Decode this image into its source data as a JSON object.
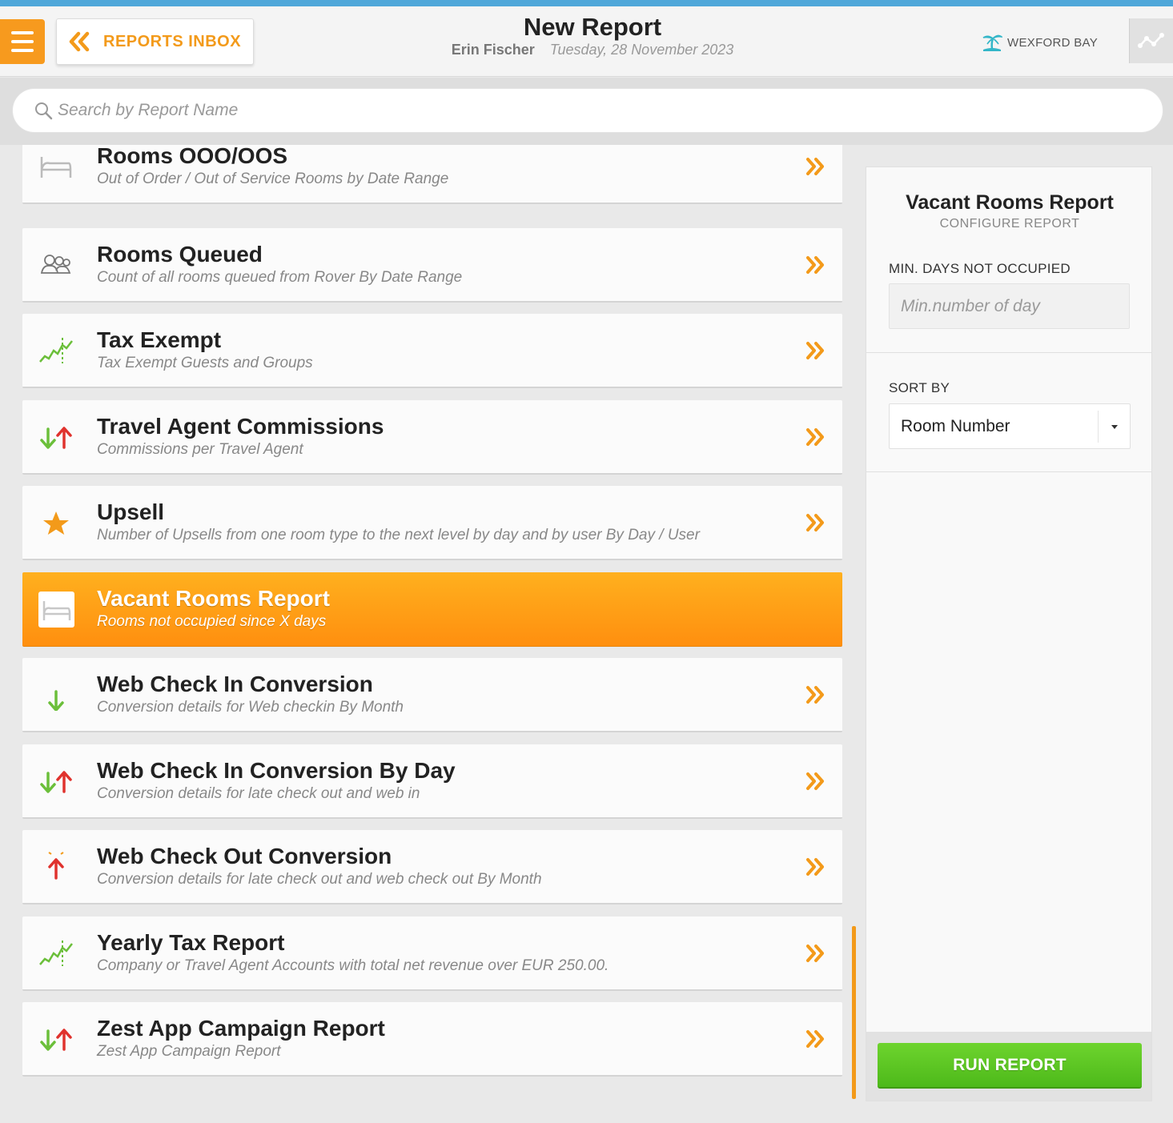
{
  "header": {
    "back_label": "REPORTS INBOX",
    "title": "New Report",
    "user": "Erin Fischer",
    "date": "Tuesday, 28 November 2023",
    "hotel": "WEXFORD BAY"
  },
  "search": {
    "placeholder": "Search by Report Name"
  },
  "reports": [
    {
      "name": "Rooms OOO/OOS",
      "desc": "Out of Order / Out of Service Rooms by Date Range",
      "icon": "bed-icon"
    },
    {
      "name": "Rooms Queued",
      "desc": "Count of all rooms queued from Rover By Date Range",
      "icon": "guests-icon"
    },
    {
      "name": "Tax Exempt",
      "desc": "Tax Exempt Guests and Groups",
      "icon": "trend-chart-icon"
    },
    {
      "name": "Travel Agent Commissions",
      "desc": "Commissions per Travel Agent",
      "icon": "arrows-up-down-icon"
    },
    {
      "name": "Upsell",
      "desc": "Number of Upsells from one room type to the next level by day and by user By Day / User",
      "icon": "star-icon"
    },
    {
      "name": "Vacant Rooms Report",
      "desc": "Rooms not occupied since X days",
      "icon": "bed-icon",
      "selected": true
    },
    {
      "name": "Web Check In Conversion",
      "desc": "Conversion details for Web checkin By Month",
      "icon": "arrow-down-icon"
    },
    {
      "name": "Web Check In Conversion By Day",
      "desc": "Conversion details for late check out and web in",
      "icon": "arrows-up-down-icon"
    },
    {
      "name": "Web Check Out Conversion",
      "desc": "Conversion details for late check out and web check out By Month",
      "icon": "arrow-up-icon"
    },
    {
      "name": "Yearly Tax Report",
      "desc": "Company or Travel Agent Accounts with total net revenue over EUR 250.00.",
      "icon": "trend-chart-icon"
    },
    {
      "name": "Zest App Campaign Report",
      "desc": "Zest App Campaign Report",
      "icon": "arrows-up-down-icon"
    }
  ],
  "panel": {
    "title": "Vacant Rooms Report",
    "subtitle": "CONFIGURE REPORT",
    "min_days_label": "MIN. DAYS NOT OCCUPIED",
    "min_days_placeholder": "Min.number of day",
    "sort_label": "SORT BY",
    "sort_value": "Room Number",
    "run_label": "RUN REPORT"
  },
  "colors": {
    "accent_orange": "#f39a1a",
    "run_green": "#5cc524",
    "top_stripe": "#4fa7d9"
  }
}
